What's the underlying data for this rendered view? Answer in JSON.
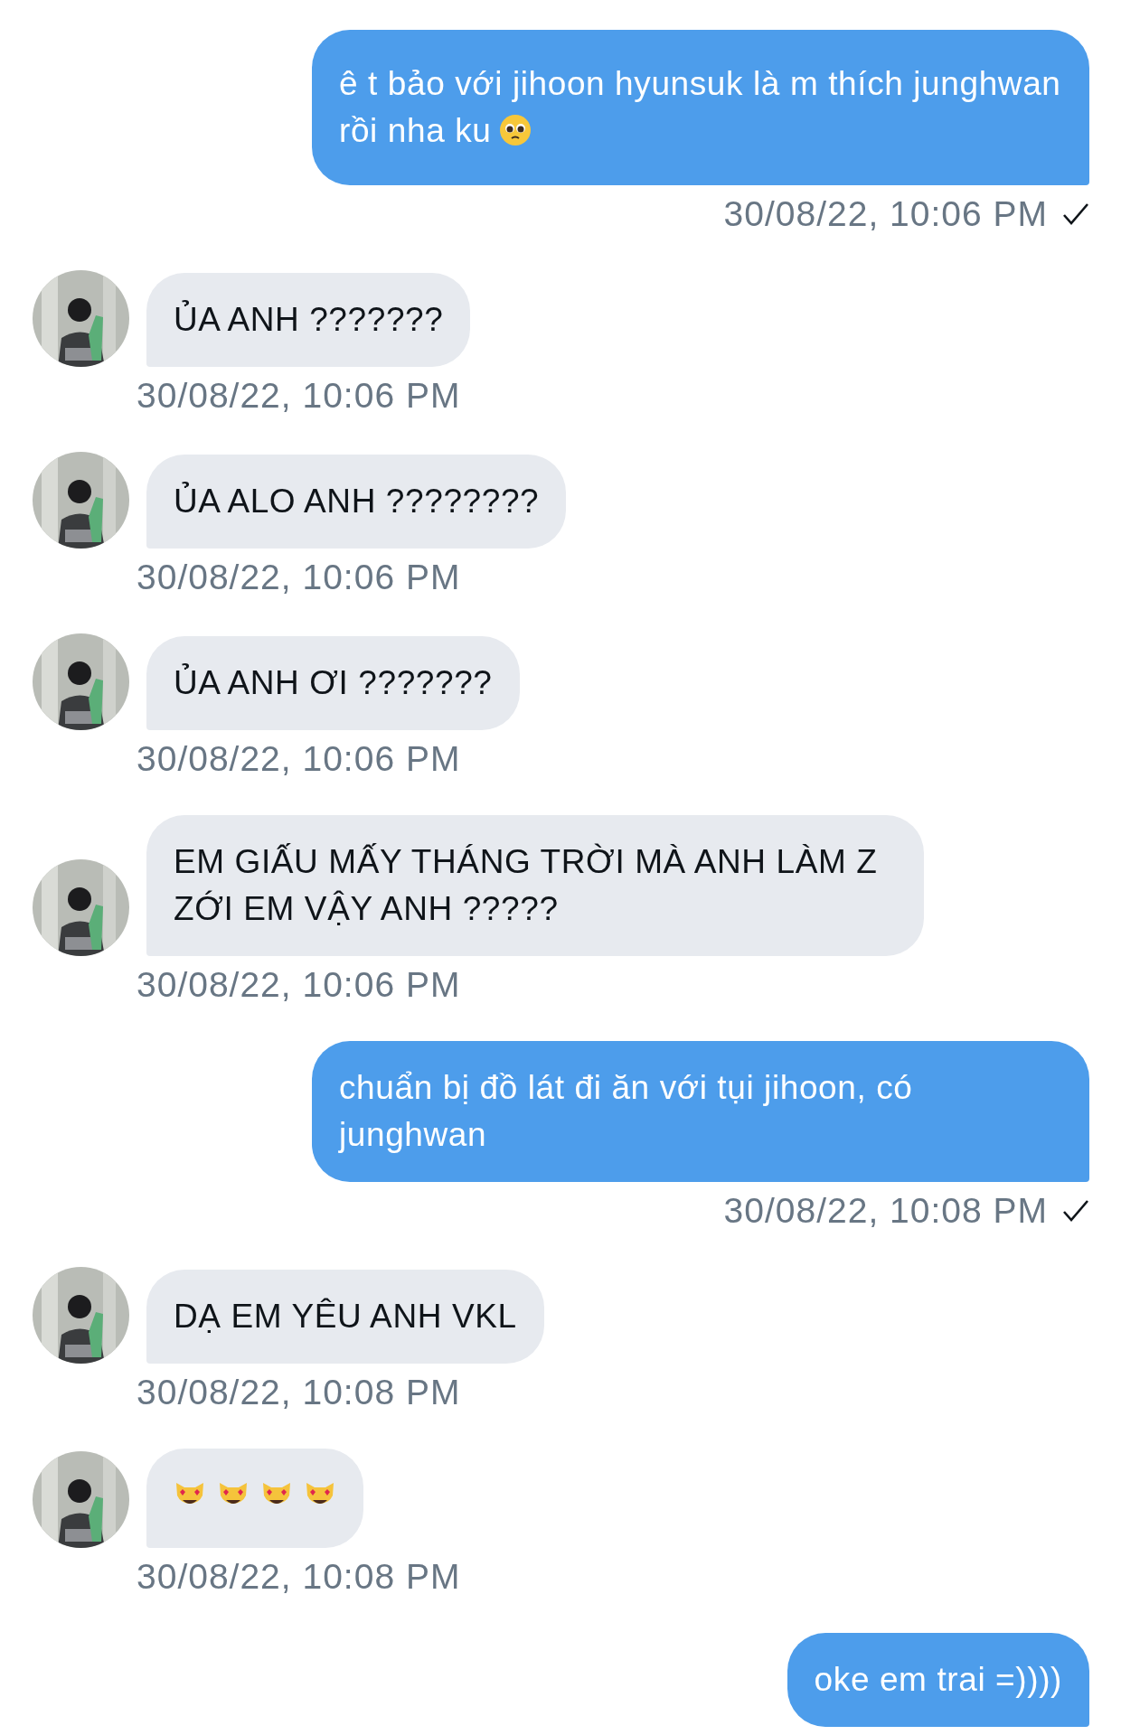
{
  "messages": [
    {
      "kind": "sent",
      "text": "ê t bảo với jihoon hyunsuk là m thích junghwan rồi nha ku",
      "emoji": [
        {
          "kind": "pleading"
        }
      ],
      "time": "30/08/22, 10:06 PM",
      "read": true
    },
    {
      "kind": "received",
      "text": "ỦA ANH ???????",
      "time": "30/08/22, 10:06 PM"
    },
    {
      "kind": "received",
      "text": "ỦA ALO ANH ????????",
      "time": "30/08/22, 10:06 PM"
    },
    {
      "kind": "received",
      "text": "ỦA ANH ƠI ???????",
      "time": "30/08/22, 10:06 PM"
    },
    {
      "kind": "received",
      "text": "EM GIẤU MẤY THÁNG TRỜI MÀ ANH LÀM Z ZỚI EM VẬY ANH ?????",
      "time": "30/08/22, 10:06 PM"
    },
    {
      "kind": "sent",
      "text": "chuẩn bị đồ lát đi ăn với tụi jihoon, có junghwan",
      "time": "30/08/22, 10:08 PM",
      "read": true
    },
    {
      "kind": "received",
      "text": "DẠ EM YÊU ANH VKL",
      "time": "30/08/22, 10:08 PM"
    },
    {
      "kind": "received",
      "emoji": [
        {
          "kind": "heart_eyes_cat"
        },
        {
          "kind": "heart_eyes_cat"
        },
        {
          "kind": "heart_eyes_cat"
        },
        {
          "kind": "heart_eyes_cat"
        }
      ],
      "time": "30/08/22, 10:08 PM"
    },
    {
      "kind": "sent",
      "text": "oke em trai =))))"
    }
  ]
}
